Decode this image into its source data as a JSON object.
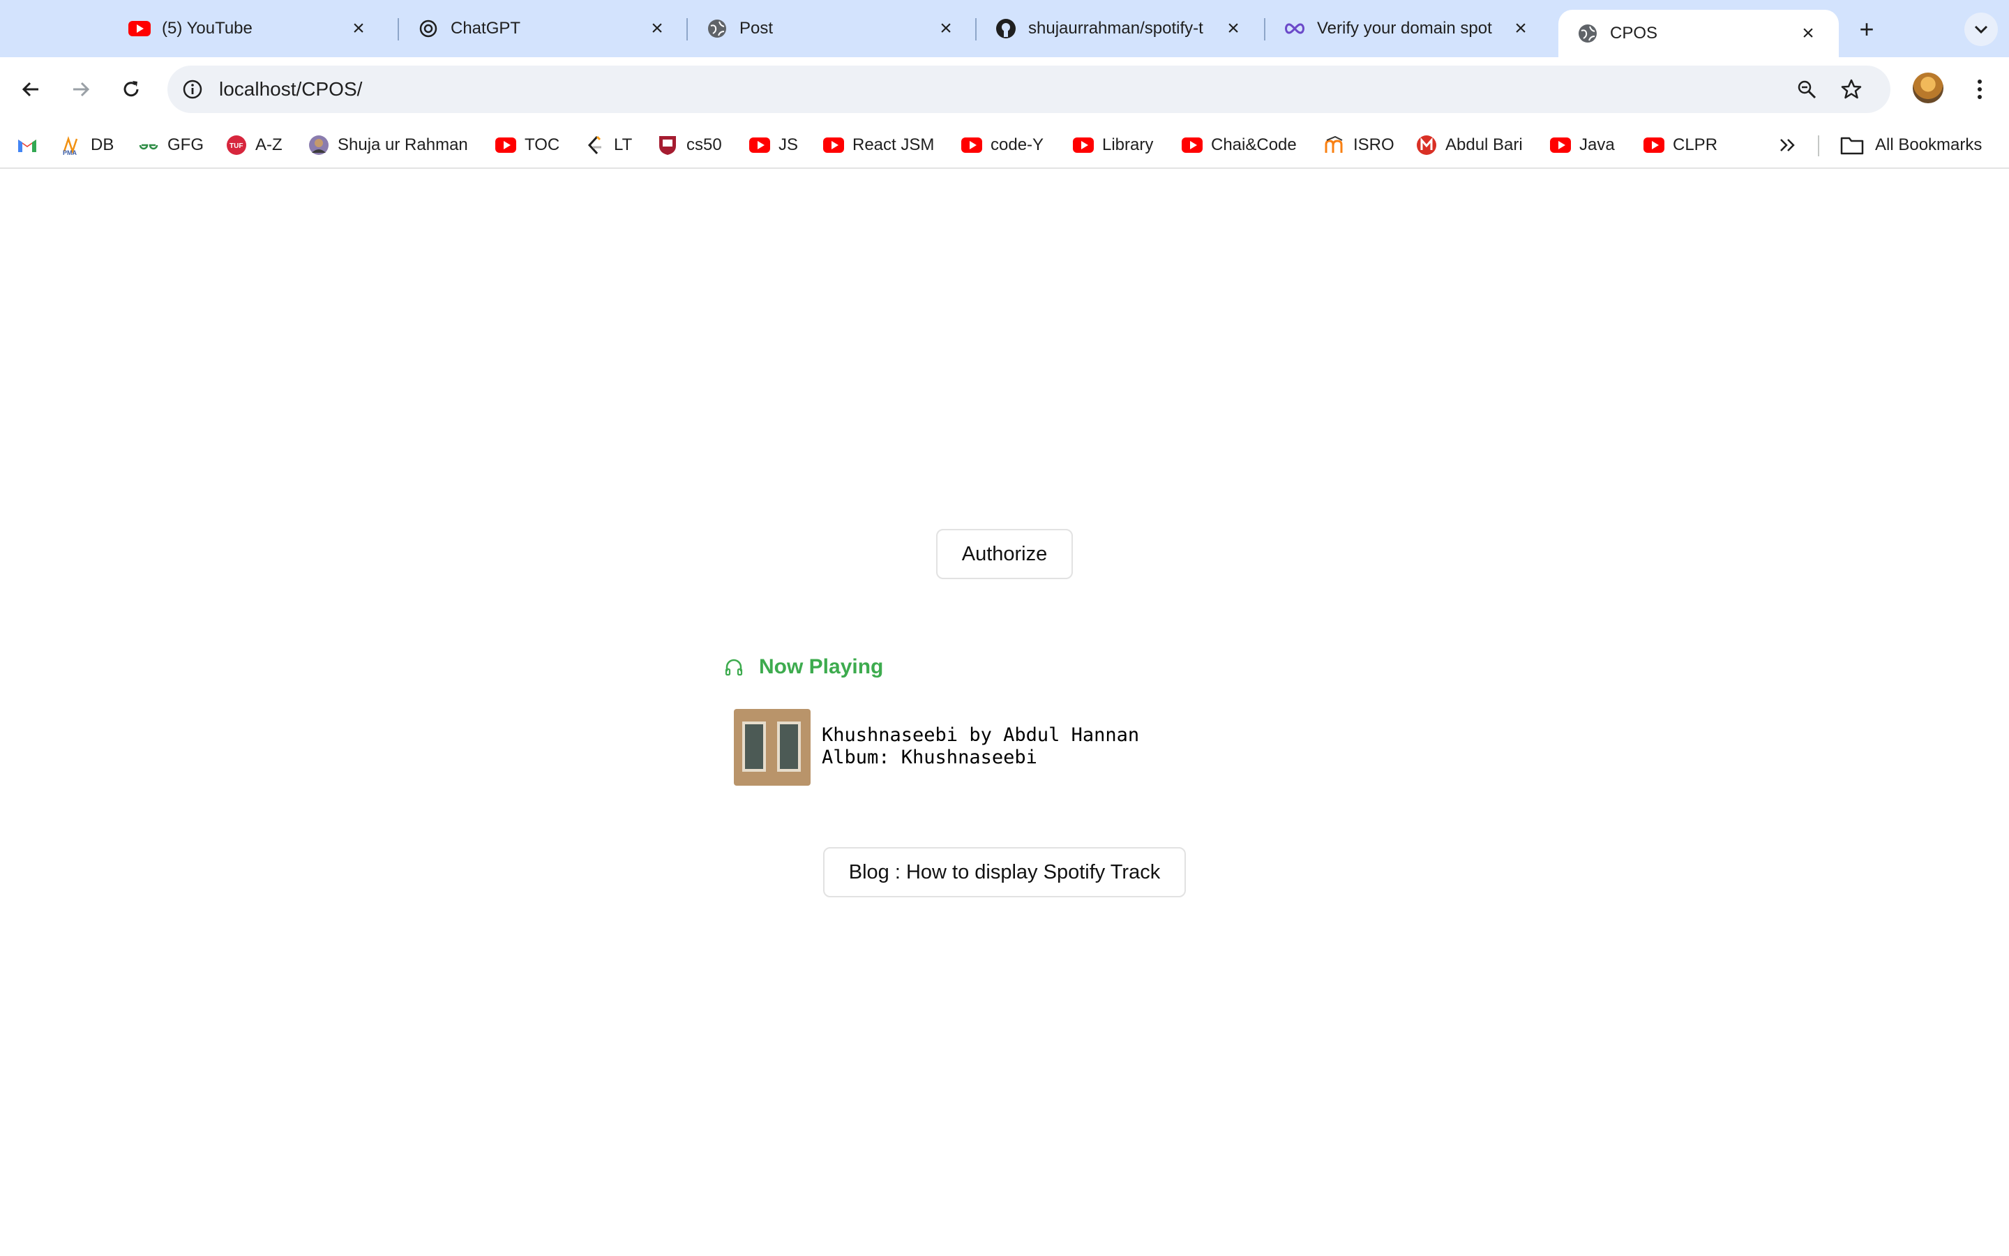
{
  "browser": {
    "tabs": [
      {
        "title": "(5) YouTube",
        "icon": "youtube-icon"
      },
      {
        "title": "ChatGPT",
        "icon": "chatgpt-icon"
      },
      {
        "title": "Post",
        "icon": "globe-icon"
      },
      {
        "title": "shujaurrahman/spotify-t",
        "icon": "github-icon"
      },
      {
        "title": "Verify your domain spot",
        "icon": "infinity-icon"
      },
      {
        "title": "CPOS",
        "icon": "globe-icon",
        "active": true
      }
    ],
    "url": "localhost/CPOS/",
    "bookmarks": [
      {
        "label": "",
        "icon": "gmail-icon"
      },
      {
        "label": "DB",
        "icon": "pma-icon"
      },
      {
        "label": "GFG",
        "icon": "gfg-icon"
      },
      {
        "label": "A-Z",
        "icon": "tuf-icon"
      },
      {
        "label": "Shuja ur Rahman",
        "icon": "avatar-icon"
      },
      {
        "label": "TOC",
        "icon": "youtube-icon"
      },
      {
        "label": "LT",
        "icon": "leetcode-icon"
      },
      {
        "label": "cs50",
        "icon": "harvard-icon"
      },
      {
        "label": "JS",
        "icon": "youtube-icon"
      },
      {
        "label": "React JSM",
        "icon": "youtube-icon"
      },
      {
        "label": "code-Y",
        "icon": "youtube-icon"
      },
      {
        "label": "Library",
        "icon": "youtube-icon"
      },
      {
        "label": "Chai&Code",
        "icon": "youtube-icon"
      },
      {
        "label": "ISRO",
        "icon": "moodle-icon"
      },
      {
        "label": "Abdul Bari",
        "icon": "bari-icon"
      },
      {
        "label": "Java",
        "icon": "youtube-icon"
      },
      {
        "label": "CLPR",
        "icon": "youtube-icon"
      }
    ],
    "all_bookmarks_label": "All Bookmarks"
  },
  "page": {
    "authorize_label": "Authorize",
    "now_playing_label": "Now Playing",
    "track": {
      "line1": "Khushnaseebi by Abdul Hannan",
      "line2": "Album: Khushnaseebi"
    },
    "blog_label": "Blog : How to display Spotify Track"
  },
  "colors": {
    "tabstrip": "#d3e3fd",
    "now_playing": "#3dab4e",
    "youtube_red": "#ff0000"
  }
}
